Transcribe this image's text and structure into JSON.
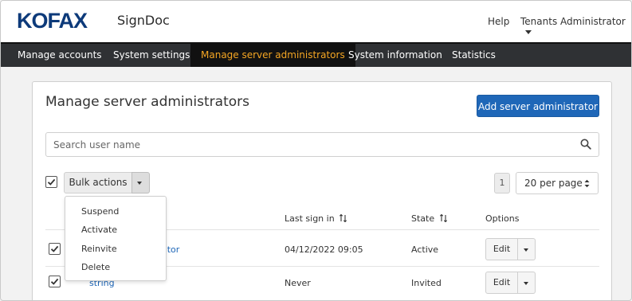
{
  "header": {
    "logo": "KOFAX",
    "app_name": "SignDoc",
    "help": "Help",
    "tenant": "Tenants Administrator"
  },
  "nav": {
    "items": [
      {
        "label": "Manage accounts"
      },
      {
        "label": "System settings"
      },
      {
        "label": "Manage server administrators"
      },
      {
        "label": "System information"
      },
      {
        "label": "Statistics"
      }
    ],
    "active_index": 2
  },
  "main": {
    "title": "Manage server administrators",
    "add_button": "Add server administrator",
    "search_placeholder": "Search user name",
    "bulk_actions": "Bulk actions",
    "bulk_menu": [
      "Suspend",
      "Activate",
      "Reinvite",
      "Delete"
    ],
    "page_number": "1",
    "per_page": "20 per page",
    "columns": {
      "last_sign_in": "Last sign in",
      "state": "State",
      "options": "Options"
    },
    "rows": [
      {
        "name_visible": "ator",
        "last_sign_in": "04/12/2022 09:05",
        "state": "Active",
        "edit": "Edit",
        "checked": true
      },
      {
        "name_visible": "string",
        "last_sign_in": "Never",
        "state": "Invited",
        "edit": "Edit",
        "checked": true
      }
    ]
  },
  "colors": {
    "brand": "#0d3a7a",
    "primary": "#1f67b8",
    "nav_bg": "#2f3134",
    "nav_active_text": "#f5a623"
  },
  "icons": {
    "search": "search-icon",
    "sort": "sort-icon",
    "dropdown": "chevron-down-icon",
    "checkbox": "checkmark-icon"
  }
}
